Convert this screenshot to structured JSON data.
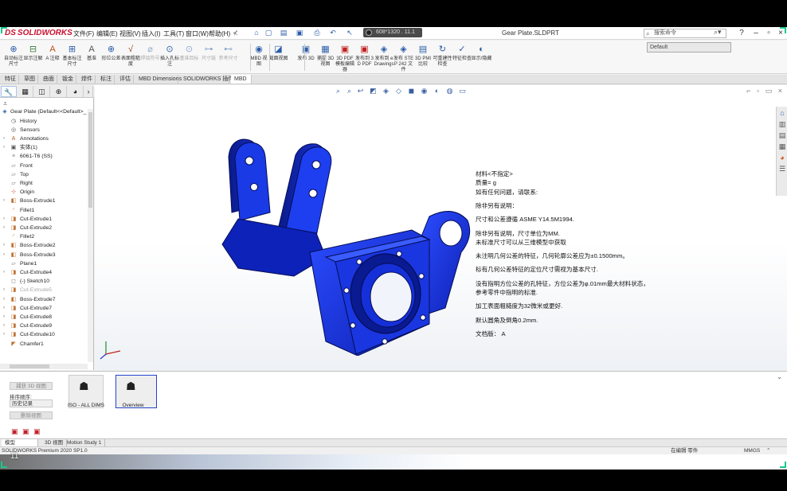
{
  "titlebar": {
    "logo_mark": "DS",
    "logo_text": "SOLIDWORKS",
    "menus": [
      "文件(F)",
      "编辑(E)",
      "视图(V)",
      "插入(I)",
      "工具(T)",
      "窗口(W)",
      "帮助(H)"
    ],
    "overlay_tag": "608*1320 . 11.1",
    "document_title": "Gear Plate.SLDPRT",
    "search_placeholder": "搜索命令"
  },
  "ribbon": {
    "buttons": [
      {
        "label": "自动标注尺寸",
        "icon": "dimension-icon"
      },
      {
        "label": "显示注解",
        "icon": "annotation-icon"
      },
      {
        "label": "A 注释",
        "icon": "note-icon"
      },
      {
        "label": "基本标注尺寸",
        "icon": "basic-dim-icon"
      },
      {
        "label": "基准",
        "icon": "datum-icon"
      },
      {
        "label": "形位公差",
        "icon": "gtol-icon"
      },
      {
        "label": "表面粗糙度",
        "icon": "surface-finish-icon"
      },
      {
        "label": "焊接符号",
        "icon": "weld-icon",
        "dim": true
      },
      {
        "label": "插入孔标注",
        "icon": "hole-callout-icon"
      },
      {
        "label": "基准目标",
        "icon": "datum-target-icon",
        "dim": true
      },
      {
        "label": "尺寸链",
        "icon": "dim-chain-icon",
        "dim": true
      },
      {
        "label": "参考尺寸",
        "icon": "ref-dim-icon",
        "dim": true
      },
      {
        "label": "MBD 视图",
        "icon": "mbd-view-icon"
      },
      {
        "label": "截面视图",
        "icon": "section-icon"
      },
      {
        "label": "发布 3D",
        "icon": "publish-icon"
      },
      {
        "label": "捕捉 3D 视图",
        "icon": "capture-icon"
      },
      {
        "label": "3D PDF 模板编辑器",
        "icon": "pdf-template-icon"
      },
      {
        "label": "发布到 3D PDF",
        "icon": "pdf-icon"
      },
      {
        "label": "发布到 eDrawings",
        "icon": "edrawings-icon"
      },
      {
        "label": "发布 STEP 242 文件",
        "icon": "step-icon"
      },
      {
        "label": "3D PMI 比较",
        "icon": "pmi-compare-icon"
      },
      {
        "label": "可重建性检查",
        "icon": "rebuild-icon"
      },
      {
        "label": "特征检查",
        "icon": "feature-check-icon"
      },
      {
        "label": "显示/隐藏",
        "icon": "show-hide-icon"
      }
    ],
    "configuration": "Default"
  },
  "command_tabs": [
    "特征",
    "草图",
    "曲面",
    "钣金",
    "焊件",
    "标注",
    "评估",
    "MBD Dimensions",
    "SOLIDWORKS 插件",
    "MBD"
  ],
  "active_command_tab": "MBD",
  "feature_tree": {
    "root": "Gear Plate  (Default<<Default>_",
    "items": [
      {
        "label": "History",
        "icon": "history-icon",
        "expandable": false
      },
      {
        "label": "Sensors",
        "icon": "sensor-icon",
        "expandable": false
      },
      {
        "label": "Annotations",
        "icon": "annotation-folder-icon",
        "expandable": true
      },
      {
        "label": "实体(1)",
        "icon": "solid-bodies-icon",
        "expandable": true
      },
      {
        "label": "6061-T6 (SS)",
        "icon": "material-icon",
        "expandable": false
      },
      {
        "label": "Front",
        "icon": "plane-icon",
        "expandable": false
      },
      {
        "label": "Top",
        "icon": "plane-icon",
        "expandable": false
      },
      {
        "label": "Right",
        "icon": "plane-icon",
        "expandable": false
      },
      {
        "label": "Origin",
        "icon": "origin-icon",
        "expandable": false
      },
      {
        "label": "Boss-Extrude1",
        "icon": "extrude-icon",
        "expandable": true
      },
      {
        "label": "Fillet1",
        "icon": "fillet-icon",
        "expandable": false
      },
      {
        "label": "Cut-Extrude1",
        "icon": "cut-icon",
        "expandable": true
      },
      {
        "label": "Cut-Extrude2",
        "icon": "cut-icon",
        "expandable": true
      },
      {
        "label": "Fillet2",
        "icon": "fillet-icon",
        "expandable": false
      },
      {
        "label": "Boss-Extrude2",
        "icon": "extrude-icon",
        "expandable": true
      },
      {
        "label": "Boss-Extrude3",
        "icon": "extrude-icon",
        "expandable": true
      },
      {
        "label": "Plane1",
        "icon": "plane-icon",
        "expandable": false
      },
      {
        "label": "Cut-Extrude4",
        "icon": "cut-icon",
        "expandable": true
      },
      {
        "label": "(-) Sketch10",
        "icon": "sketch-icon",
        "expandable": false
      },
      {
        "label": "Cut-Extrude5",
        "icon": "cut-icon",
        "expandable": true,
        "suppressed": true
      },
      {
        "label": "Boss-Extrude7",
        "icon": "extrude-icon",
        "expandable": true
      },
      {
        "label": "Cut-Extrude7",
        "icon": "cut-icon",
        "expandable": true
      },
      {
        "label": "Cut-Extrude8",
        "icon": "cut-icon",
        "expandable": true
      },
      {
        "label": "Cut-Extrude9",
        "icon": "cut-icon",
        "expandable": true
      },
      {
        "label": "Cut-Extrude10",
        "icon": "cut-icon",
        "expandable": true
      },
      {
        "label": "Chamfer1",
        "icon": "chamfer-icon",
        "expandable": false
      }
    ]
  },
  "notes": [
    "材料<不指定>",
    "质量=  g",
    "如有任何问题，请联系:",
    "",
    "除非另有说明：",
    "",
    "尺寸和公差遵循 ASME Y14.5M1994.",
    "",
    "除非另有说明，尺寸单位为MM.",
    "未标准尺寸可以从三维模型中获取",
    "",
    "未注明几何公差的特征，几何轮廓公差应为±0.1500mm。",
    "",
    "标有几何公差特征的定位尺寸需视为基本尺寸.",
    "",
    "没有指明方位公差的孔特征，方位公差为φ.01mm最大材料状态，",
    "参考零件中指明的标准.",
    "",
    "加工表面粗糙度为32微米或更好.",
    "",
    "默认圆角及倒角0.2mm.",
    "",
    "文档版：      A"
  ],
  "view_palette": {
    "update_button": "捕获 3D 视图",
    "sort_label": "排序顺序:",
    "sort_value": "历史记录",
    "delete_button": "删除视图",
    "views": [
      {
        "name": "ISO - ALL DIMS",
        "selected": false
      },
      {
        "name": "Overview",
        "selected": true
      }
    ]
  },
  "bottom_tabs": [
    "模型",
    "3D 视图",
    "Motion Study 1"
  ],
  "active_bottom_tab": "模型",
  "status": {
    "product": "SOLIDWORKS Premium 2020 SP1.0",
    "mode": "在编辑 零件",
    "units": "MMGS"
  },
  "frame_number": "11",
  "colors": {
    "part_blue": "#1530d8",
    "part_dark": "#0a1a8a",
    "accent_green": "#18c98a",
    "selected_border": "#2244cc"
  }
}
